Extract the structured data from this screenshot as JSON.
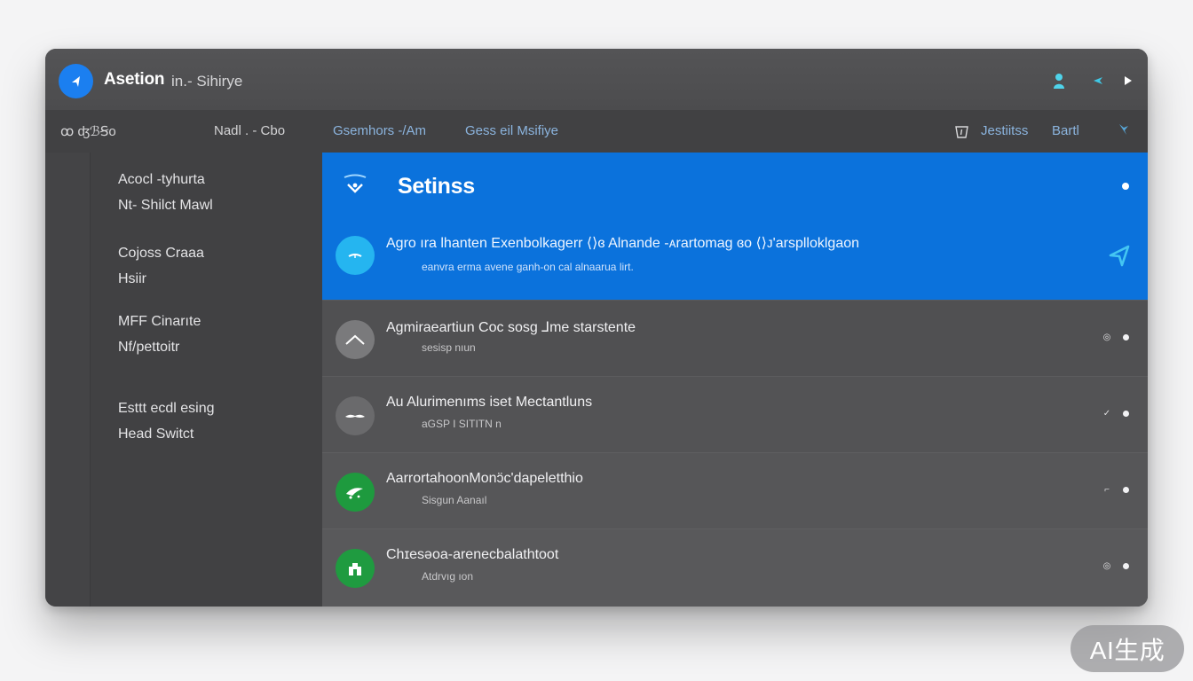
{
  "titlebar": {
    "title": "Asetion",
    "subtitle": "in.- Sihirye",
    "logo_icon": "back-arrow-icon",
    "icons": [
      "user-icon",
      "cast-icon",
      "play-icon"
    ]
  },
  "toolbar": {
    "items": [
      {
        "label": "ꝏ ʤℬꞨo"
      },
      {
        "label": "Nadl . - Cbo"
      },
      {
        "label": "Gsemhors  -/Am"
      },
      {
        "label": "Gess eil   Msifiye"
      },
      {
        "label": "Jestiitss"
      },
      {
        "label": "Bartl"
      }
    ],
    "icons": [
      "shield-icon",
      "pin-icon"
    ]
  },
  "sidebar": {
    "groups": [
      {
        "line1": "Acocl -tyhurta",
        "line2": "Nt- Shilct Mawl"
      },
      {
        "line1": "Cojoss Craaa",
        "line2": "Hsiir"
      },
      {
        "line1": "MFF Cinarıte",
        "line2": "Nf/pettoitr"
      },
      {
        "line1": "Esttt ecdl esing",
        "line2": "Head  Switct"
      }
    ]
  },
  "main": {
    "header": {
      "title": "Setinss",
      "icon": "wifi-shield-icon"
    },
    "selected": {
      "title": "Agro ıra  lhanten Exenbolkagerr ⟨⟩‍ɞ Alnande -ᴀrartomag ɞo ⟨⟩ᴊ'arsplloklgaon",
      "subtitle": "eanvra erma avene ganh-on cal alnaarua lirt.",
      "icon": "cloud-icon",
      "action_icon": "send-icon"
    },
    "rows": [
      {
        "title": "Agmiraeartiun Coc sosg  ⅃me  starstente",
        "subtitle": "sesisp nıun",
        "small_icon": "◎",
        "avatar_color": "#7a7a7c",
        "icon": "chart-line-icon"
      },
      {
        "title": "Au Alurimenıms iset Mectantluns",
        "subtitle": "aGSP I  SITITN n",
        "small_icon": "✓",
        "avatar_color": "#6a6a6c",
        "icon": "mustache-icon"
      },
      {
        "title": "AarrortahoonMonɔ̈c'dapeletthio",
        "subtitle": "Sisgun  Aanaıl",
        "small_icon": "⌐",
        "avatar_color": "#1e9a3e",
        "icon": "leaf-icon"
      },
      {
        "title": "Chɪesəoa-arenecbalathtoot",
        "subtitle": "Atdrvıg ıon",
        "small_icon": "◎",
        "avatar_color": "#1f9b40",
        "icon": "building-icon"
      }
    ]
  },
  "badge": {
    "label": "AI生成"
  }
}
